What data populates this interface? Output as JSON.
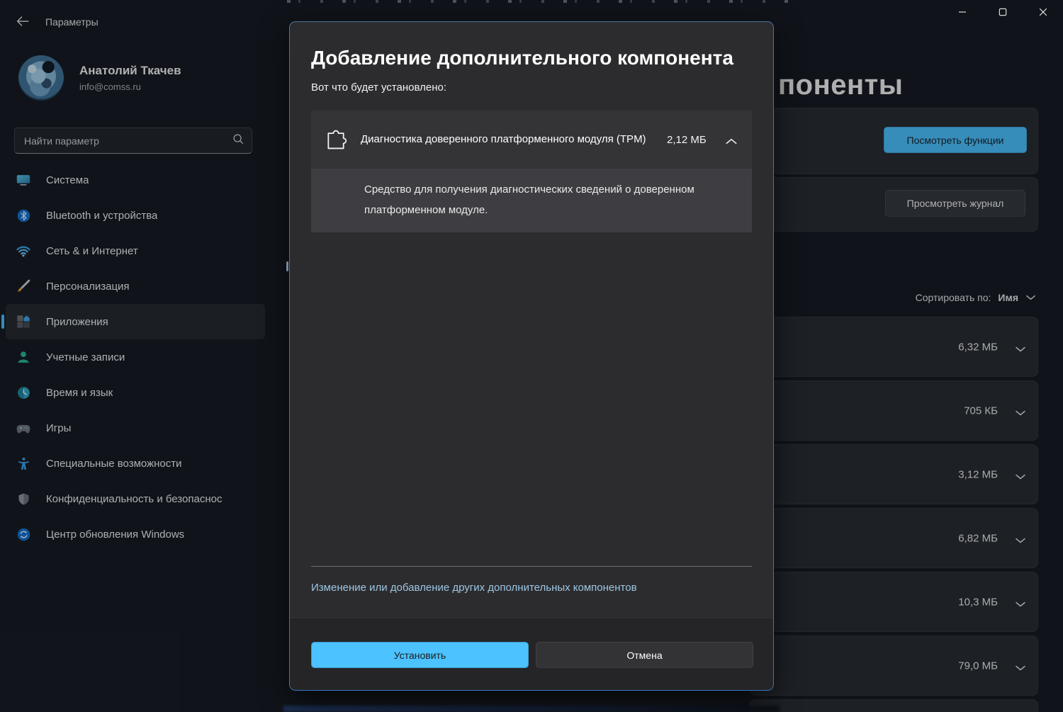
{
  "titlebar": {
    "app_title": "Параметры",
    "back_icon": "back-arrow-icon",
    "controls": [
      "minimize-icon",
      "maximize-icon",
      "close-icon"
    ]
  },
  "sidebar": {
    "user": {
      "name": "Анатолий Ткачев",
      "email": "info@comss.ru"
    },
    "search": {
      "placeholder": "Найти параметр",
      "icon": "search-icon"
    },
    "items": [
      {
        "label": "Система",
        "icon": "system-icon",
        "selected": false
      },
      {
        "label": "Bluetooth и устройства",
        "icon": "bluetooth-icon",
        "selected": false
      },
      {
        "label": "Сеть & и Интернет",
        "icon": "network-icon",
        "selected": false
      },
      {
        "label": "Персонализация",
        "icon": "personalization-icon",
        "selected": false
      },
      {
        "label": "Приложения",
        "icon": "apps-icon",
        "selected": true
      },
      {
        "label": "Учетные записи",
        "icon": "accounts-icon",
        "selected": false
      },
      {
        "label": "Время и язык",
        "icon": "time-language-icon",
        "selected": false
      },
      {
        "label": "Игры",
        "icon": "gaming-icon",
        "selected": false
      },
      {
        "label": "Специальные возможности",
        "icon": "accessibility-icon",
        "selected": false
      },
      {
        "label": "Конфиденциальность и безопаснос",
        "icon": "privacy-icon",
        "selected": false
      },
      {
        "label": "Центр обновления Windows",
        "icon": "windows-update-icon",
        "selected": false
      }
    ]
  },
  "main": {
    "heading_fragment": "поненты",
    "view_features_button": "Посмотреть функции",
    "view_history_button": "Просмотреть журнал",
    "sort": {
      "label": "Сортировать по:",
      "value": "Имя",
      "icon": "chevron-down-icon"
    },
    "feature_rows": [
      {
        "size": "6,32 МБ"
      },
      {
        "size": "705 КБ"
      },
      {
        "size": "3,12 МБ"
      },
      {
        "size": "6,82 МБ"
      },
      {
        "size": "10,3 МБ"
      },
      {
        "size": "79,0 МБ"
      }
    ]
  },
  "dialog": {
    "title": "Добавление дополнительного компонента",
    "subtitle": "Вот что будет установлено:",
    "component": {
      "icon": "puzzle-piece-icon",
      "name": "Диагностика доверенного платформенного модуля (TPM)",
      "size": "2,12 МБ",
      "expand_icon": "chevron-up-icon",
      "description": "Средство для получения диагностических сведений о доверенном платформенном модуле."
    },
    "link": "Изменение или добавление других дополнительных компонентов",
    "install_button": "Установить",
    "cancel_button": "Отмена"
  },
  "colors": {
    "accent": "#4cc2ff",
    "link": "#9dc6e4",
    "dialog_border": "#4f739c"
  }
}
